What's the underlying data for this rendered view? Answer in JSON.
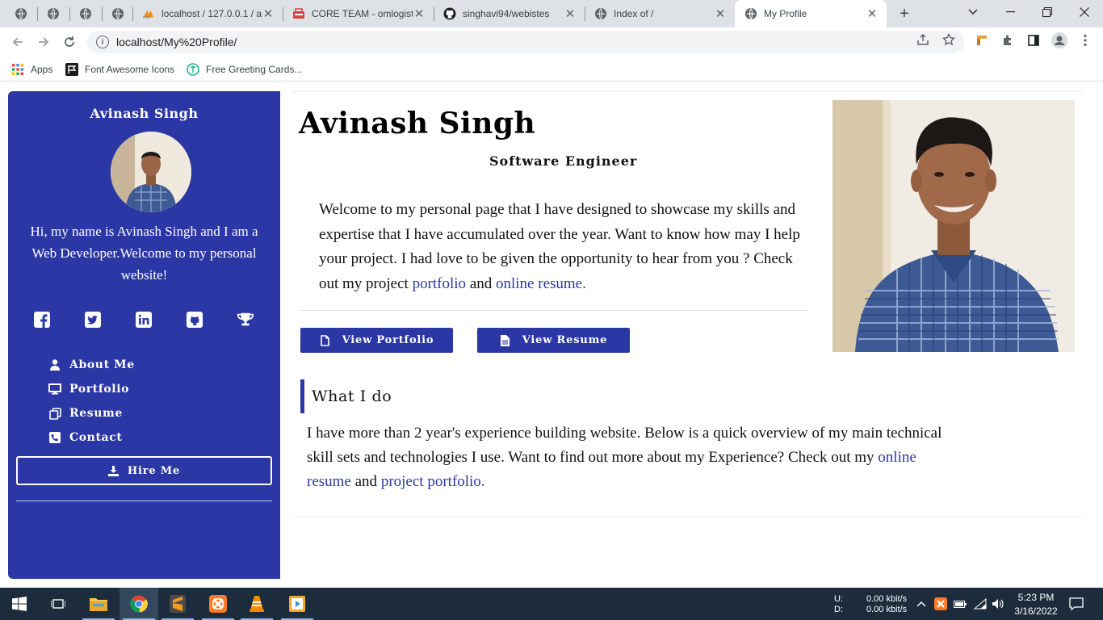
{
  "browser": {
    "tabs": [
      {
        "title": ""
      },
      {
        "title": ""
      },
      {
        "title": ""
      },
      {
        "title": ""
      },
      {
        "title": "localhost / 127.0.0.1 / a"
      },
      {
        "title": "CORE TEAM - omlogist"
      },
      {
        "title": "singhavi94/webistes"
      },
      {
        "title": "Index of /"
      },
      {
        "title": "My Profile"
      }
    ],
    "url": "localhost/My%20Profile/",
    "bookmarks": [
      {
        "label": "Apps",
        "icon": "apps-grid-icon"
      },
      {
        "label": "Font Awesome Icons",
        "icon": "font-awesome-flag-icon"
      },
      {
        "label": "Free Greeting Cards...",
        "icon": "greeting-cards-icon"
      }
    ]
  },
  "sidebar": {
    "name": "Avinash Singh",
    "intro": "Hi, my name is Avinash Singh and I am a Web Developer.Welcome to my personal website!",
    "social": [
      "facebook-icon",
      "twitter-icon",
      "linkedin-icon",
      "github-icon",
      "trophy-icon"
    ],
    "nav": [
      {
        "label": "About Me",
        "icon": "user-icon"
      },
      {
        "label": "Portfolio",
        "icon": "desktop-icon"
      },
      {
        "label": "Resume",
        "icon": "copy-icon"
      },
      {
        "label": "Contact",
        "icon": "phone-icon"
      }
    ],
    "hire_label": "Hire Me",
    "accent": "#2b37a4"
  },
  "main": {
    "name": "Avinash Singh",
    "role": "Software Engineer",
    "welcome_1": "Welcome to my personal page that I have designed to showcase my skills and expertise that I have accumulated over the year. Want to know how may I help your project. I had love to be given the opportunity to hear from you ? Check out my project ",
    "welcome_link_portfolio": "portfolio",
    "welcome_and": " and ",
    "welcome_link_resume": "online resume.",
    "btn_portfolio": "View Portfolio",
    "btn_resume": "View Resume",
    "what_title": "What I do",
    "what_1": "I have more than 2 year's experience building website. Below is a quick overview of my main technical skill sets and technologies I use. Want to find out more about my Experience? Check out my ",
    "what_link_resume": "online resume",
    "what_and": " and ",
    "what_link_portfolio": "project portfolio."
  },
  "taskbar": {
    "net_up_label": "U:",
    "net_down_label": "D:",
    "net_up": "0.00 kbit/s",
    "net_down": "0.00 kbit/s",
    "time": "5:23 PM",
    "date": "3/16/2022"
  }
}
